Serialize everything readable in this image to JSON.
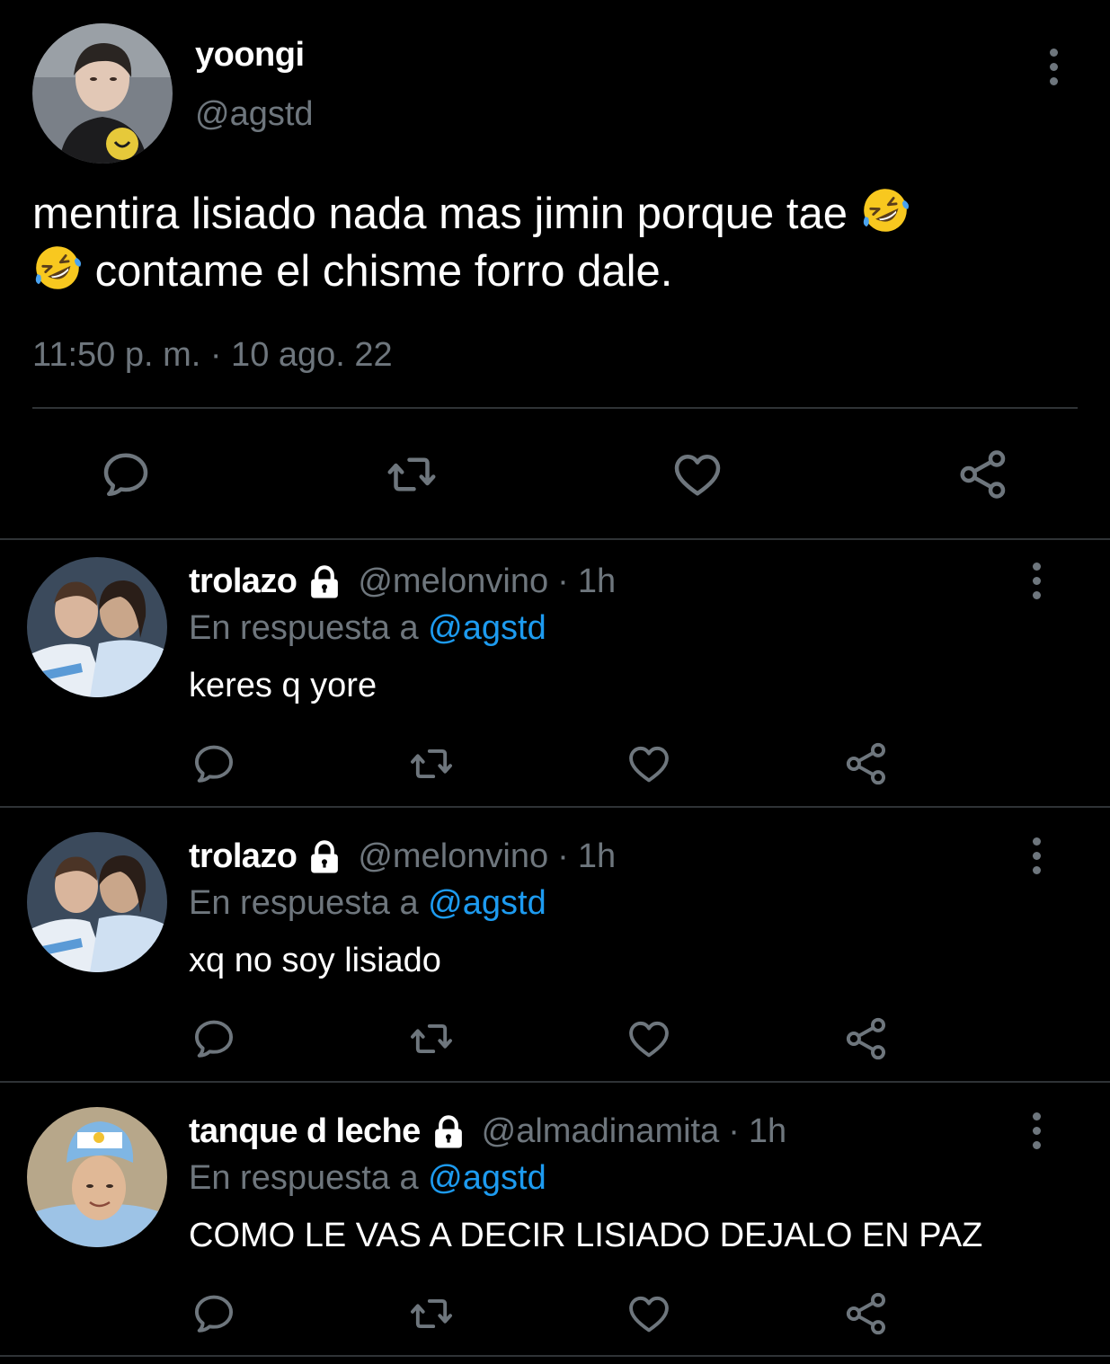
{
  "main_tweet": {
    "name": "yoongi",
    "handle": "@agstd",
    "text_line1": "mentira lisiado nada mas jimin porque tae",
    "text_line2": "contame el chisme forro dale.",
    "timestamp": "11:50 p. m. · 10 ago. 22",
    "emoji": "rolling-on-floor-laughing"
  },
  "reply_to_label": "En respuesta a",
  "replies": [
    {
      "name": "trolazo",
      "handle": "@melonvino",
      "separator": "·",
      "time": "1h",
      "reply_to": "@agstd",
      "text": "keres q yore",
      "protected": true
    },
    {
      "name": "trolazo",
      "handle": "@melonvino",
      "separator": "·",
      "time": "1h",
      "reply_to": "@agstd",
      "text": "xq no soy lisiado",
      "protected": true
    },
    {
      "name": "tanque d leche",
      "handle": "@almadinamita",
      "separator": "·",
      "time": "1h",
      "reply_to": "@agstd",
      "text": "COMO LE VAS A DECIR LISIADO DEJALO EN PAZ",
      "protected": true
    }
  ],
  "icons": {
    "reply": "reply-icon",
    "retweet": "retweet-icon",
    "like": "like-icon",
    "share": "share-icon",
    "more": "more-icon",
    "lock": "lock-icon"
  },
  "colors": {
    "background": "#000000",
    "text": "#ffffff",
    "muted": "#6e767d",
    "mention": "#1d9bf0",
    "divider": "#2f3336"
  }
}
